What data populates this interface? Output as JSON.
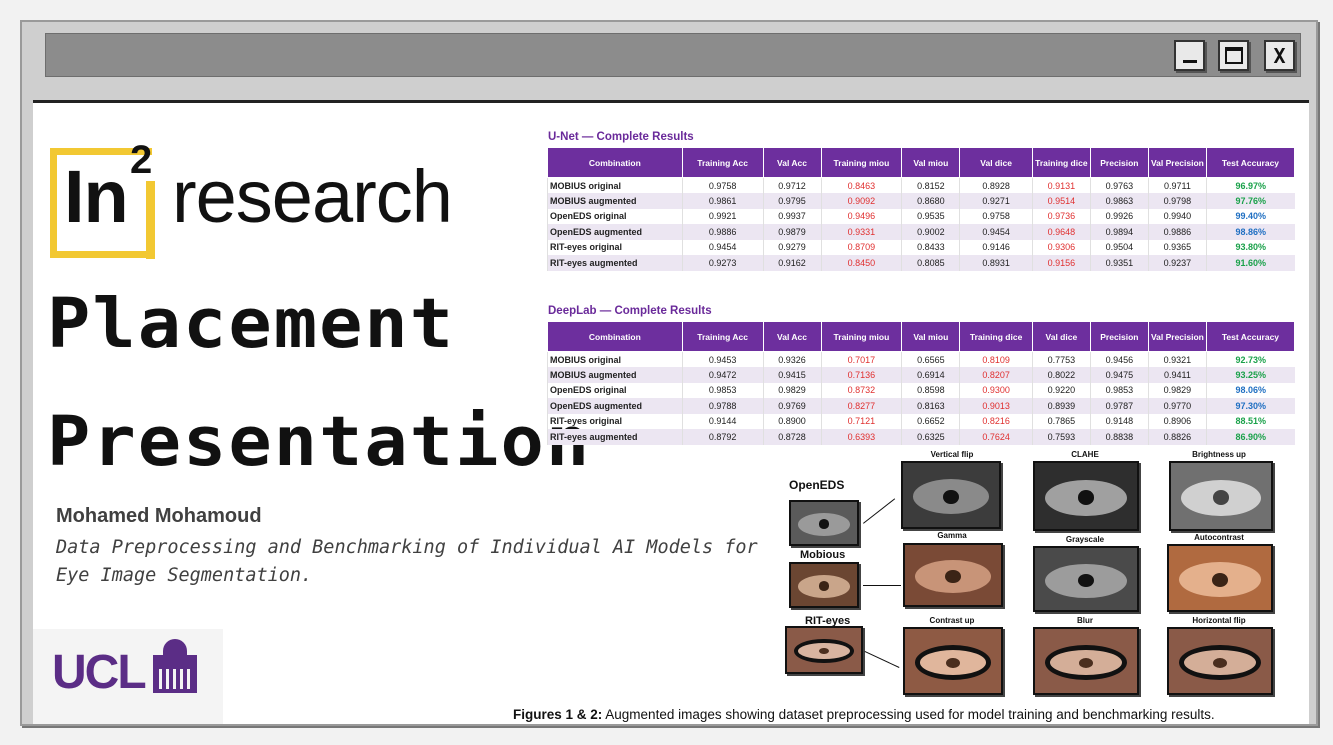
{
  "window": {
    "min_glyph": "_",
    "max_glyph": "□",
    "close_glyph": "X"
  },
  "logo": {
    "part1": "In",
    "superscript": "2",
    "part2": "research",
    "accent_color": "#f2c832"
  },
  "title_line1": "Placement",
  "title_line2": "Presentation",
  "author": "Mohamed Mohamoud",
  "subtitle": "Data Preprocessing and Benchmarking of Individual AI Models for Eye Image Segmentation.",
  "ucl_logo": {
    "text": "UCL",
    "color": "#5b2d86"
  },
  "unet": {
    "title": "U-Net — Complete Results",
    "headers": [
      "Combination",
      "Training Acc",
      "Val Acc",
      "Training miou",
      "Val miou",
      "Val dice",
      "Training dice",
      "Precision",
      "Val Precision",
      "Test Accuracy"
    ],
    "rows": [
      [
        "MOBIUS original",
        "0.9758",
        "0.9712",
        "0.8463",
        "0.8152",
        "0.8928",
        "0.9131",
        "0.9763",
        "0.9711",
        "96.97%"
      ],
      [
        "MOBIUS augmented",
        "0.9861",
        "0.9795",
        "0.9092",
        "0.8680",
        "0.9271",
        "0.9514",
        "0.9863",
        "0.9798",
        "97.76%"
      ],
      [
        "OpenEDS original",
        "0.9921",
        "0.9937",
        "0.9496",
        "0.9535",
        "0.9758",
        "0.9736",
        "0.9926",
        "0.9940",
        "99.40%"
      ],
      [
        "OpenEDS augmented",
        "0.9886",
        "0.9879",
        "0.9331",
        "0.9002",
        "0.9454",
        "0.9648",
        "0.9894",
        "0.9886",
        "98.86%"
      ],
      [
        "RIT-eyes original",
        "0.9454",
        "0.9279",
        "0.8709",
        "0.8433",
        "0.9146",
        "0.9306",
        "0.9504",
        "0.9365",
        "93.80%"
      ],
      [
        "RIT-eyes augmented",
        "0.9273",
        "0.9162",
        "0.8450",
        "0.8085",
        "0.8931",
        "0.9156",
        "0.9351",
        "0.9237",
        "91.60%"
      ]
    ],
    "acc_colors": [
      "green",
      "green",
      "blue",
      "blue",
      "green",
      "green"
    ]
  },
  "deeplab": {
    "title": "DeepLab — Complete Results",
    "headers": [
      "Combination",
      "Training Acc",
      "Val Acc",
      "Training miou",
      "Val miou",
      "Training dice",
      "Val dice",
      "Precision",
      "Val Precision",
      "Test Accuracy"
    ],
    "rows": [
      [
        "MOBIUS original",
        "0.9453",
        "0.9326",
        "0.7017",
        "0.6565",
        "0.8109",
        "0.7753",
        "0.9456",
        "0.9321",
        "92.73%"
      ],
      [
        "MOBIUS augmented",
        "0.9472",
        "0.9415",
        "0.7136",
        "0.6914",
        "0.8207",
        "0.8022",
        "0.9475",
        "0.9411",
        "93.25%"
      ],
      [
        "OpenEDS original",
        "0.9853",
        "0.9829",
        "0.8732",
        "0.8598",
        "0.9300",
        "0.9220",
        "0.9853",
        "0.9829",
        "98.06%"
      ],
      [
        "OpenEDS augmented",
        "0.9788",
        "0.9769",
        "0.8277",
        "0.8163",
        "0.9013",
        "0.8939",
        "0.9787",
        "0.9770",
        "97.30%"
      ],
      [
        "RIT-eyes original",
        "0.9144",
        "0.8900",
        "0.7121",
        "0.6652",
        "0.8216",
        "0.7865",
        "0.9148",
        "0.8906",
        "88.51%"
      ],
      [
        "RIT-eyes augmented",
        "0.8792",
        "0.8728",
        "0.6393",
        "0.6325",
        "0.7624",
        "0.7593",
        "0.8838",
        "0.8826",
        "86.90%"
      ]
    ],
    "acc_colors": [
      "green",
      "green",
      "blue",
      "blue",
      "green",
      "green"
    ]
  },
  "figure": {
    "datasets": [
      "OpenEDS",
      "Mobious",
      "RIT-eyes"
    ],
    "aug_labels": [
      "Vertical flip",
      "CLAHE",
      "Brightness up",
      "Gamma",
      "Grayscale",
      "Autocontrast",
      "Contrast up",
      "Blur",
      "Horizontal flip"
    ]
  },
  "caption": {
    "bold": "Figures 1 & 2:",
    "text": " Augmented images showing dataset preprocessing used for model training and benchmarking results."
  },
  "colors": {
    "purple_header": "#6d2f9e",
    "red_values": "#e03030",
    "green_acc": "#1aa14a",
    "blue_acc": "#1f6fc2"
  }
}
